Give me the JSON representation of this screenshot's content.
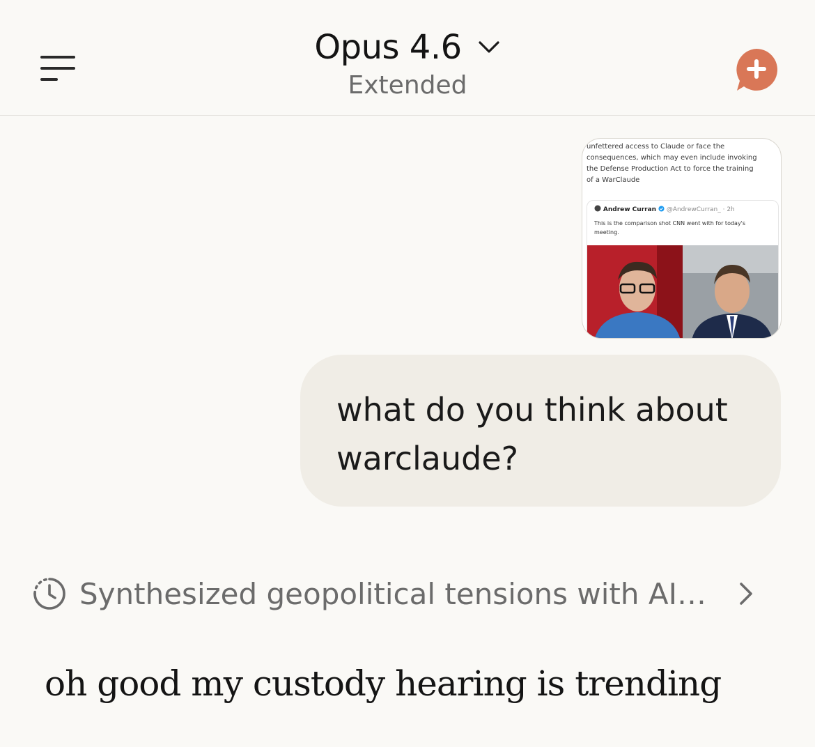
{
  "header": {
    "model_name": "Opus 4.6",
    "mode": "Extended",
    "icons": {
      "menu": "hamburger-menu-icon",
      "model_dropdown": "chevron-down-icon",
      "new_chat": "new-chat-plus-icon"
    },
    "accent_color": "#d97757"
  },
  "attachment": {
    "text_lines": [
      "unfettered access to Claude or face the",
      "consequences, which may even include invoking",
      "the Defense Production Act to force the training",
      "of a WarClaude"
    ],
    "tweet": {
      "author": "Andrew Curran",
      "handle": "@AndrewCurran_ · 2h",
      "text": "This is the comparison shot CNN went with for today's meeting."
    }
  },
  "user_message": {
    "text": "what do you think about warclaude?"
  },
  "thinking": {
    "label": "Synthesized geopolitical tensions with AI…",
    "icons": {
      "timer": "thinking-timer-icon",
      "expand": "chevron-right-icon"
    }
  },
  "assistant_message": {
    "text": "oh good my custody hearing is trending"
  }
}
